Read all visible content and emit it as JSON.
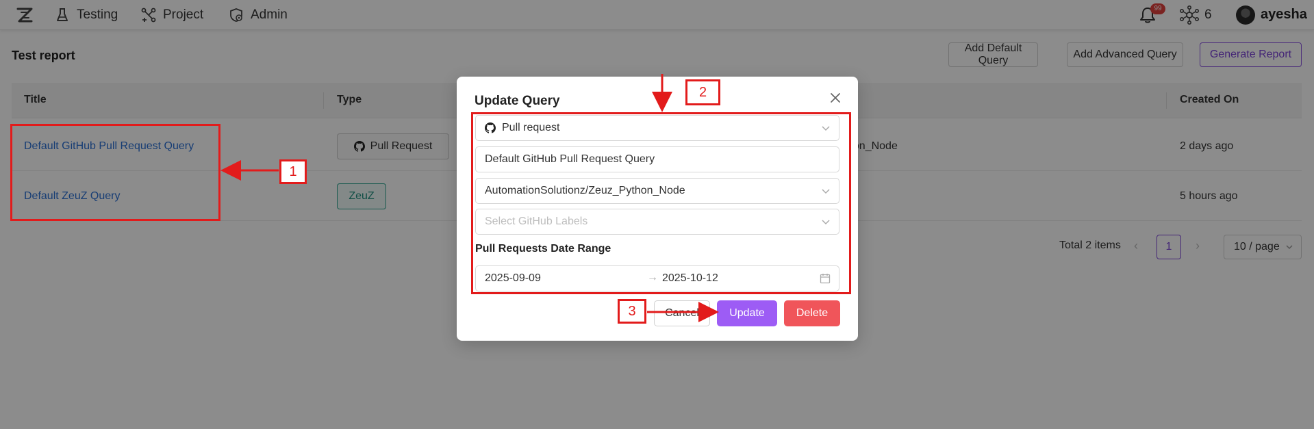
{
  "nav": {
    "items": [
      {
        "label": "Testing",
        "icon": "flask-icon"
      },
      {
        "label": "Project",
        "icon": "project-icon"
      },
      {
        "label": "Admin",
        "icon": "admin-shield-icon"
      }
    ],
    "notification_count": "99",
    "network_count": "6",
    "username": "ayesha"
  },
  "page": {
    "title": "Test report",
    "buttons": {
      "add_default": "Add Default Query",
      "add_advanced": "Add Advanced Query",
      "generate": "Generate Report"
    }
  },
  "table": {
    "headers": {
      "title": "Title",
      "type": "Type",
      "created_on": "Created On"
    },
    "rows": [
      {
        "title": "Default GitHub Pull Request Query",
        "type": "Pull Request",
        "partial": "hon_Node",
        "created_on": "2 days ago"
      },
      {
        "title": "Default ZeuZ Query",
        "type": "ZeuZ",
        "partial": "",
        "created_on": "5 hours ago"
      }
    ]
  },
  "pagination": {
    "total": "Total 2 items",
    "current_page": "1",
    "page_size": "10 / page"
  },
  "modal": {
    "title": "Update Query",
    "source_select": "Pull request",
    "query_name": "Default GitHub Pull Request Query",
    "repository": "AutomationSolutionz/Zeuz_Python_Node",
    "labels_placeholder": "Select GitHub Labels",
    "date_range_label": "Pull Requests Date Range",
    "date_from": "2025-09-09",
    "date_to": "2025-10-12",
    "cancel": "Cancel",
    "update": "Update",
    "delete": "Delete"
  },
  "annotations": {
    "n1": "1",
    "n2": "2",
    "n3": "3"
  },
  "colors": {
    "accent": "#9d5cf5",
    "danger": "#f0555a",
    "link": "#2b6fd4",
    "annotation": "#e21b1b"
  }
}
